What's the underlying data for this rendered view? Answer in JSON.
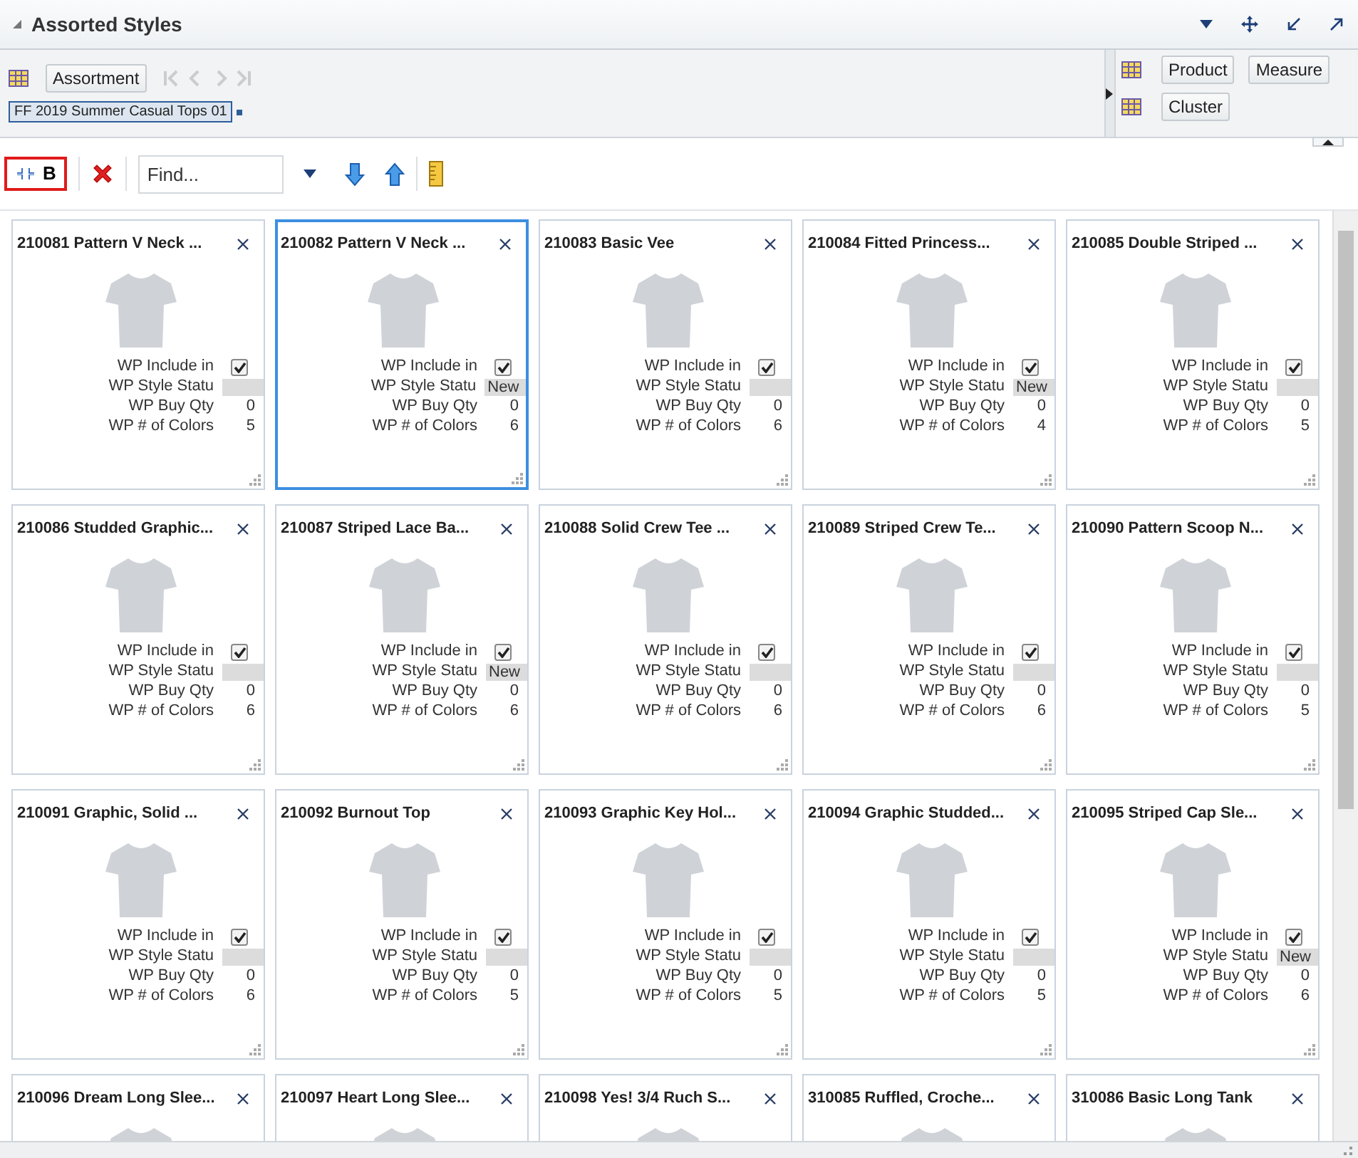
{
  "header": {
    "title": "Assorted Styles"
  },
  "context": {
    "dimension_button": "Assortment",
    "tag": "FF 2019 Summer Casual Tops 01",
    "right_buttons": [
      [
        "Product",
        "Measure"
      ],
      [
        "Cluster"
      ]
    ]
  },
  "toolbar": {
    "view_button": "B",
    "find": {
      "placeholder": "Find..."
    }
  },
  "cards": [
    {
      "title": "210081 Pattern V Neck ...",
      "selected": false,
      "fields": [
        {
          "kind": "checkbox",
          "label": "WP Include in",
          "checked": true
        },
        {
          "kind": "status",
          "label": "WP Style Statu"
        },
        {
          "kind": "number",
          "label": "WP Buy Qty",
          "value": "0"
        },
        {
          "kind": "number",
          "label": "WP # of Colors",
          "value": "5"
        }
      ]
    },
    {
      "title": "210082 Pattern V Neck ...",
      "selected": true,
      "fields": [
        {
          "kind": "checkbox",
          "label": "WP Include in",
          "checked": true
        },
        {
          "kind": "status",
          "label": "WP Style Statu",
          "value": "New"
        },
        {
          "kind": "number",
          "label": "WP Buy Qty",
          "value": "0"
        },
        {
          "kind": "number",
          "label": "WP # of Colors",
          "value": "6"
        }
      ]
    },
    {
      "title": "210083 Basic Vee",
      "selected": false,
      "fields": [
        {
          "kind": "checkbox",
          "label": "WP Include in",
          "checked": true
        },
        {
          "kind": "status",
          "label": "WP Style Statu"
        },
        {
          "kind": "number",
          "label": "WP Buy Qty",
          "value": "0"
        },
        {
          "kind": "number",
          "label": "WP # of Colors",
          "value": "6"
        }
      ]
    },
    {
      "title": "210084 Fitted Princess...",
      "selected": false,
      "fields": [
        {
          "kind": "checkbox",
          "label": "WP Include in",
          "checked": true
        },
        {
          "kind": "status",
          "label": "WP Style Statu",
          "value": "New"
        },
        {
          "kind": "number",
          "label": "WP Buy Qty",
          "value": "0"
        },
        {
          "kind": "number",
          "label": "WP # of Colors",
          "value": "4"
        }
      ]
    },
    {
      "title": "210085 Double Striped ...",
      "selected": false,
      "fields": [
        {
          "kind": "checkbox",
          "label": "WP Include in",
          "checked": true
        },
        {
          "kind": "status",
          "label": "WP Style Statu"
        },
        {
          "kind": "number",
          "label": "WP Buy Qty",
          "value": "0"
        },
        {
          "kind": "number",
          "label": "WP # of Colors",
          "value": "5"
        }
      ]
    },
    {
      "title": "210086 Studded Graphic...",
      "selected": false,
      "fields": [
        {
          "kind": "checkbox",
          "label": "WP Include in",
          "checked": true
        },
        {
          "kind": "status",
          "label": "WP Style Statu"
        },
        {
          "kind": "number",
          "label": "WP Buy Qty",
          "value": "0"
        },
        {
          "kind": "number",
          "label": "WP # of Colors",
          "value": "6"
        }
      ]
    },
    {
      "title": "210087 Striped Lace Ba...",
      "selected": false,
      "fields": [
        {
          "kind": "checkbox",
          "label": "WP Include in",
          "checked": true
        },
        {
          "kind": "status",
          "label": "WP Style Statu",
          "value": "New"
        },
        {
          "kind": "number",
          "label": "WP Buy Qty",
          "value": "0"
        },
        {
          "kind": "number",
          "label": "WP # of Colors",
          "value": "6"
        }
      ]
    },
    {
      "title": "210088 Solid Crew Tee ...",
      "selected": false,
      "fields": [
        {
          "kind": "checkbox",
          "label": "WP Include in",
          "checked": true
        },
        {
          "kind": "status",
          "label": "WP Style Statu"
        },
        {
          "kind": "number",
          "label": "WP Buy Qty",
          "value": "0"
        },
        {
          "kind": "number",
          "label": "WP # of Colors",
          "value": "6"
        }
      ]
    },
    {
      "title": "210089 Striped Crew Te...",
      "selected": false,
      "fields": [
        {
          "kind": "checkbox",
          "label": "WP Include in",
          "checked": true
        },
        {
          "kind": "status",
          "label": "WP Style Statu"
        },
        {
          "kind": "number",
          "label": "WP Buy Qty",
          "value": "0"
        },
        {
          "kind": "number",
          "label": "WP # of Colors",
          "value": "6"
        }
      ]
    },
    {
      "title": "210090 Pattern Scoop N...",
      "selected": false,
      "fields": [
        {
          "kind": "checkbox",
          "label": "WP Include in",
          "checked": true
        },
        {
          "kind": "status",
          "label": "WP Style Statu"
        },
        {
          "kind": "number",
          "label": "WP Buy Qty",
          "value": "0"
        },
        {
          "kind": "number",
          "label": "WP # of Colors",
          "value": "5"
        }
      ]
    },
    {
      "title": "210091 Graphic, Solid ...",
      "selected": false,
      "fields": [
        {
          "kind": "checkbox",
          "label": "WP Include in",
          "checked": true
        },
        {
          "kind": "status",
          "label": "WP Style Statu"
        },
        {
          "kind": "number",
          "label": "WP Buy Qty",
          "value": "0"
        },
        {
          "kind": "number",
          "label": "WP # of Colors",
          "value": "6"
        }
      ]
    },
    {
      "title": "210092 Burnout Top",
      "selected": false,
      "fields": [
        {
          "kind": "checkbox",
          "label": "WP Include in",
          "checked": true
        },
        {
          "kind": "status",
          "label": "WP Style Statu"
        },
        {
          "kind": "number",
          "label": "WP Buy Qty",
          "value": "0"
        },
        {
          "kind": "number",
          "label": "WP # of Colors",
          "value": "5"
        }
      ]
    },
    {
      "title": "210093 Graphic Key Hol...",
      "selected": false,
      "fields": [
        {
          "kind": "checkbox",
          "label": "WP Include in",
          "checked": true
        },
        {
          "kind": "status",
          "label": "WP Style Statu"
        },
        {
          "kind": "number",
          "label": "WP Buy Qty",
          "value": "0"
        },
        {
          "kind": "number",
          "label": "WP # of Colors",
          "value": "5"
        }
      ]
    },
    {
      "title": "210094 Graphic Studded...",
      "selected": false,
      "fields": [
        {
          "kind": "checkbox",
          "label": "WP Include in",
          "checked": true
        },
        {
          "kind": "status",
          "label": "WP Style Statu"
        },
        {
          "kind": "number",
          "label": "WP Buy Qty",
          "value": "0"
        },
        {
          "kind": "number",
          "label": "WP # of Colors",
          "value": "5"
        }
      ]
    },
    {
      "title": "210095 Striped Cap Sle...",
      "selected": false,
      "fields": [
        {
          "kind": "checkbox",
          "label": "WP Include in",
          "checked": true
        },
        {
          "kind": "status",
          "label": "WP Style Statu",
          "value": "New"
        },
        {
          "kind": "number",
          "label": "WP Buy Qty",
          "value": "0"
        },
        {
          "kind": "number",
          "label": "WP # of Colors",
          "value": "6"
        }
      ]
    },
    {
      "title": "210096 Dream Long Slee...",
      "selected": false
    },
    {
      "title": "210097 Heart Long Slee...",
      "selected": false
    },
    {
      "title": "210098 Yes! 3/4 Ruch S...",
      "selected": false
    },
    {
      "title": "310085 Ruffled, Croche...",
      "selected": false
    },
    {
      "title": "310086 Basic Long Tank",
      "selected": false
    }
  ]
}
